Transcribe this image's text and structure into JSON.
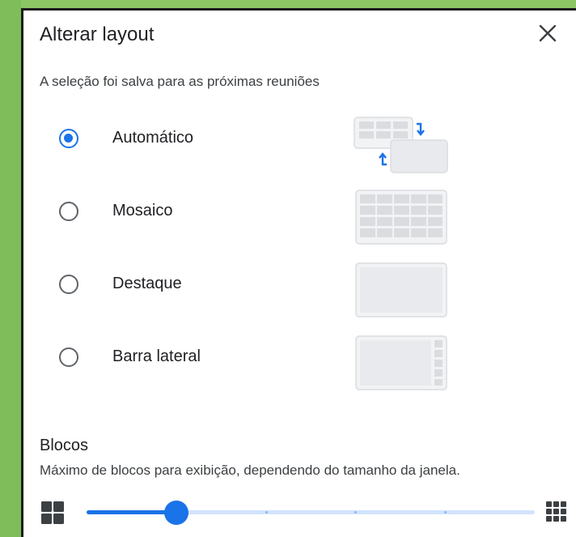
{
  "dialog": {
    "title": "Alterar layout",
    "subtitle": "A seleção foi salva para as próximas reuniões"
  },
  "layout_options": [
    {
      "label": "Automático",
      "selected": true,
      "icon": "auto-layout-icon"
    },
    {
      "label": "Mosaico",
      "selected": false,
      "icon": "tiled-layout-icon"
    },
    {
      "label": "Destaque",
      "selected": false,
      "icon": "spotlight-layout-icon"
    },
    {
      "label": "Barra lateral",
      "selected": false,
      "icon": "sidebar-layout-icon"
    }
  ],
  "tiles": {
    "title": "Blocos",
    "description": "Máximo de blocos para exibição, dependendo do tamanho da janela.",
    "slider_level_fraction": 0.2,
    "slider_stops": 6
  },
  "colors": {
    "accent": "#1a73e8",
    "background": "#8cc665"
  }
}
